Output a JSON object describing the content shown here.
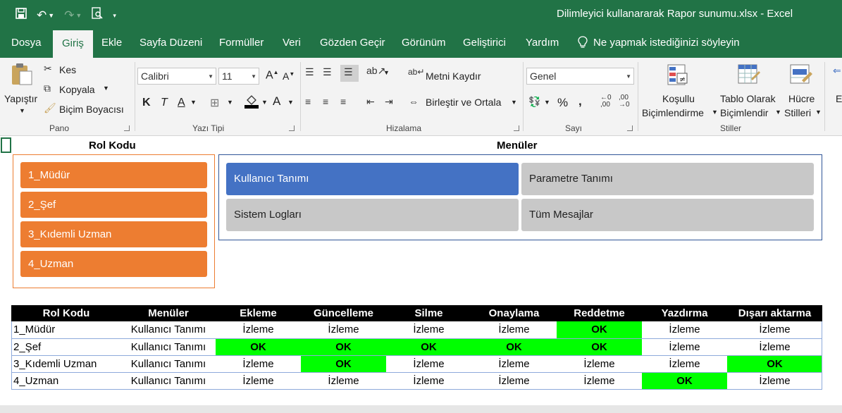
{
  "window": {
    "title": "Dilimleyici kullanararak Rapor sunumu.xlsx  -  Excel"
  },
  "ribbon_tabs": [
    "Dosya",
    "Giriş",
    "Ekle",
    "Sayfa Düzeni",
    "Formüller",
    "Veri",
    "Gözden Geçir",
    "Görünüm",
    "Geliştirici",
    "Yardım"
  ],
  "active_tab": "Giriş",
  "tell_me": "Ne yapmak istediğinizi söyleyin",
  "clipboard": {
    "paste": "Yapıştır",
    "cut": "Kes",
    "copy": "Kopyala",
    "format_painter": "Biçim Boyacısı",
    "label": "Pano"
  },
  "font": {
    "name": "Calibri",
    "size": "11",
    "bold": "K",
    "italic": "T",
    "underline": "A",
    "color_a": "A",
    "label": "Yazı Tipi"
  },
  "alignment": {
    "wrap": "Metni Kaydır",
    "merge": "Birleştir ve Ortala",
    "label": "Hizalama"
  },
  "number": {
    "format": "Genel",
    "percent": "%",
    "comma": ",",
    "label": "Sayı"
  },
  "styles": {
    "cond_1": "Koşullu",
    "cond_2": "Biçimlendirme",
    "table_1": "Tablo Olarak",
    "table_2": "Biçimlendir",
    "cell_1": "Hücre",
    "cell_2": "Stilleri",
    "label": "Stiller",
    "partial": "E"
  },
  "slicers": {
    "role_title": "Rol Kodu",
    "roles": [
      "1_Müdür",
      "2_Şef",
      "3_Kıdemli Uzman",
      "4_Uzman"
    ],
    "menu_title": "Menüler",
    "menus": [
      "Kullanıcı Tanımı",
      "Parametre Tanımı",
      "Sistem Logları",
      "Tüm Mesajlar"
    ],
    "selected_menu": "Kullanıcı Tanımı"
  },
  "table": {
    "headers": [
      "Rol Kodu",
      "Menüler",
      "Ekleme",
      "Güncelleme",
      "Silme",
      "Onaylama",
      "Reddetme",
      "Yazdırma",
      "Dışarı aktarma"
    ],
    "rows": [
      [
        "1_Müdür",
        "Kullanıcı Tanımı",
        "İzleme",
        "İzleme",
        "İzleme",
        "İzleme",
        "OK",
        "İzleme",
        "İzleme"
      ],
      [
        "2_Şef",
        "Kullanıcı Tanımı",
        "OK",
        "OK",
        "OK",
        "OK",
        "OK",
        "İzleme",
        "İzleme"
      ],
      [
        "3_Kıdemli Uzman",
        "Kullanıcı Tanımı",
        "İzleme",
        "OK",
        "İzleme",
        "İzleme",
        "İzleme",
        "İzleme",
        "OK"
      ],
      [
        "4_Uzman",
        "Kullanıcı Tanımı",
        "İzleme",
        "İzleme",
        "İzleme",
        "İzleme",
        "İzleme",
        "OK",
        "İzleme"
      ]
    ]
  },
  "colors": {
    "excel_green": "#217346",
    "role_slicer": "#ed7d31",
    "menu_selected": "#4472c4",
    "menu_unselected": "#c8c8c8",
    "ok_fill": "#00ff00"
  }
}
